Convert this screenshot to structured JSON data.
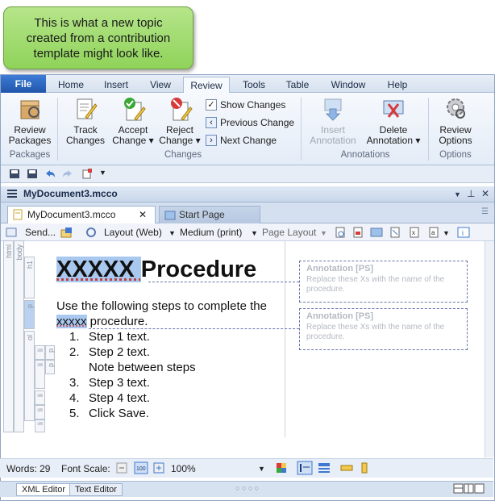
{
  "callout": {
    "text": "This is what a new topic created from a contribution template might look like."
  },
  "ribbon_tabs": [
    "File",
    "Home",
    "Insert",
    "View",
    "Review",
    "Tools",
    "Table",
    "Window",
    "Help"
  ],
  "ribbon": {
    "review_packages": "Review\nPackages",
    "group_packages": "Packages",
    "track_changes": "Track\nChanges",
    "accept_change": "Accept\nChange ▾",
    "reject_change": "Reject\nChange ▾",
    "show_changes": "Show Changes",
    "previous_change": "Previous Change",
    "next_change": "Next Change",
    "group_changes": "Changes",
    "insert_annotation": "Insert\nAnnotation",
    "delete_annotation": "Delete\nAnnotation ▾",
    "group_annotations": "Annotations",
    "review_options": "Review\nOptions",
    "group_options": "Options"
  },
  "document": {
    "window_title": "MyDocument3.mcco",
    "tab_active": "MyDocument3.mcco",
    "tab_start": "Start Page",
    "toolbar": {
      "send": "Send...",
      "layout": "Layout (Web)",
      "medium": "Medium (print)",
      "page_layout": "Page Layout"
    },
    "tag_labels": [
      "html",
      "body",
      "h1",
      "p",
      "ol",
      "li",
      "p",
      "li",
      "p",
      "li",
      "li",
      "li"
    ],
    "heading_sel": "XXXXX ",
    "heading_rest": "Procedure",
    "intro_line1": "Use the following steps to complete the",
    "intro_sel": "xxxxx",
    "intro_rest": " procedure.",
    "steps": [
      {
        "num": "1.",
        "text": "Step 1 text."
      },
      {
        "num": "2.",
        "text": "Step 2 text."
      },
      {
        "num": "",
        "text": "Note between steps"
      },
      {
        "num": "3.",
        "text": "Step 3 text."
      },
      {
        "num": "4.",
        "text": "Step 4 text."
      },
      {
        "num": "5.",
        "text": "Click Save."
      }
    ],
    "annotations": [
      {
        "title": "Annotation [PS]",
        "body": "Replace these Xs with the name of the procedure."
      },
      {
        "title": "Annotation [PS]",
        "body": "Replace these Xs with the name of the procedure."
      }
    ]
  },
  "status": {
    "words": "Words: 29",
    "font_scale": "Font Scale:",
    "zoom": "100%"
  },
  "bottom_tabs": [
    "XML Editor",
    "Text Editor"
  ],
  "colors": {
    "callout": "#9ad66a",
    "file_tab": "#2b63b8",
    "selection": "#a9c8ef",
    "annotation_border": "#6677aa"
  }
}
